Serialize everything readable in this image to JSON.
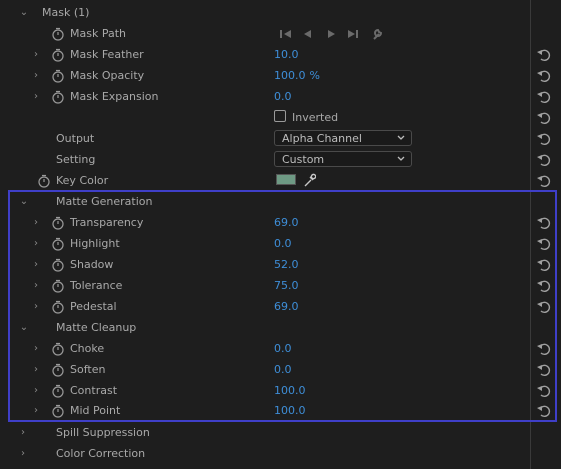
{
  "mask_section": {
    "title": "Mask (1)",
    "mask_path_label": "Mask Path",
    "rows": [
      {
        "label": "Mask Feather",
        "value": "10.0",
        "unit": ""
      },
      {
        "label": "Mask Opacity",
        "value": "100.0",
        "unit": "%"
      },
      {
        "label": "Mask Expansion",
        "value": "0.0",
        "unit": ""
      }
    ],
    "inverted_label": "Inverted",
    "inverted_checked": false
  },
  "output": {
    "label": "Output",
    "selected": "Alpha Channel"
  },
  "setting": {
    "label": "Setting",
    "selected": "Custom"
  },
  "key_color": {
    "label": "Key Color",
    "color": "#6e9a84"
  },
  "matte_generation": {
    "title": "Matte Generation",
    "rows": [
      {
        "label": "Transparency",
        "value": "69.0"
      },
      {
        "label": "Highlight",
        "value": "0.0"
      },
      {
        "label": "Shadow",
        "value": "52.0"
      },
      {
        "label": "Tolerance",
        "value": "75.0"
      },
      {
        "label": "Pedestal",
        "value": "69.0"
      }
    ]
  },
  "matte_cleanup": {
    "title": "Matte Cleanup",
    "rows": [
      {
        "label": "Choke",
        "value": "0.0"
      },
      {
        "label": "Soften",
        "value": "0.0"
      },
      {
        "label": "Contrast",
        "value": "100.0"
      },
      {
        "label": "Mid Point",
        "value": "100.0"
      }
    ]
  },
  "spill_suppression": {
    "title": "Spill Suppression"
  },
  "color_correction": {
    "title": "Color Correction"
  },
  "colors": {
    "background": "#1e1e1e",
    "label_text": "#a9a9a9",
    "value_blue": "#3e8ed8",
    "highlight_border": "#3f3fc8",
    "key_swatch": "#6e9a84"
  }
}
